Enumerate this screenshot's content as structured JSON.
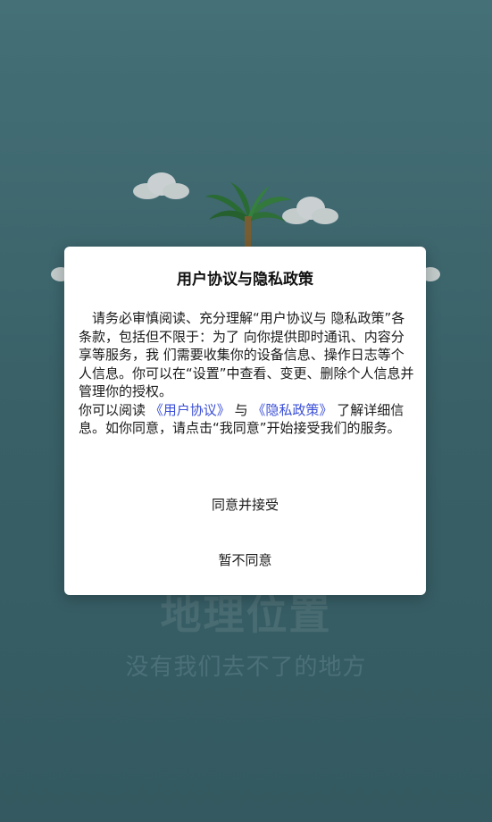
{
  "splash": {
    "title": "地理位置",
    "subtitle": "没有我们去不了的地方"
  },
  "dialog": {
    "title": "用户协议与隐私政策",
    "paragraph1": "请务必审慎阅读、充分理解“用户协议与 隐私政策”各条款，包括但不限于：为了 向你提供即时通讯、内容分享等服务，我 们需要收集你的设备信息、操作日志等个 人信息。你可以在“设置”中查看、变更、删除个人信息并管理你的授权。",
    "p2_prefix": "你可以阅读",
    "user_agreement_link": "《用户协议》",
    "p2_and": "与",
    "privacy_policy_link": "《隐私政策》",
    "p2_suffix": "了解详细信息。如你同意，请点击“我同意”开始接受我们的服务。",
    "agree_button": "同意并接受",
    "decline_button": "暂不同意"
  },
  "colors": {
    "background": "#426f77",
    "link": "#3b4fd6",
    "dialog_bg": "#ffffff"
  }
}
